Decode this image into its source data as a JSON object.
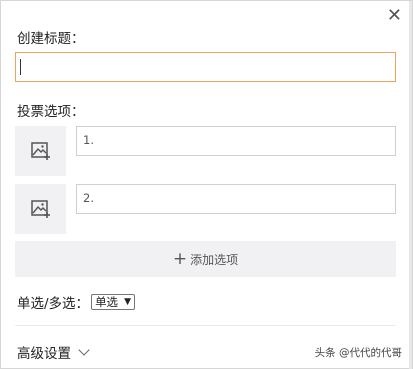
{
  "dialog": {
    "close_glyph": "✕"
  },
  "title_section": {
    "label": "创建标题：",
    "value": ""
  },
  "options_section": {
    "label": "投票选项：",
    "items": [
      {
        "placeholder": "1."
      },
      {
        "placeholder": "2."
      }
    ],
    "add_label": "添加选项",
    "add_glyph": "+"
  },
  "mode": {
    "label": "单选/多选：",
    "selected": "单选",
    "arrow": "▼"
  },
  "advanced": {
    "label": "高级设置"
  },
  "watermark": {
    "text": "头条 @代代的代哥"
  },
  "colors": {
    "focus_border": "#f0a35a",
    "panel_bg": "#f1f1f3"
  }
}
